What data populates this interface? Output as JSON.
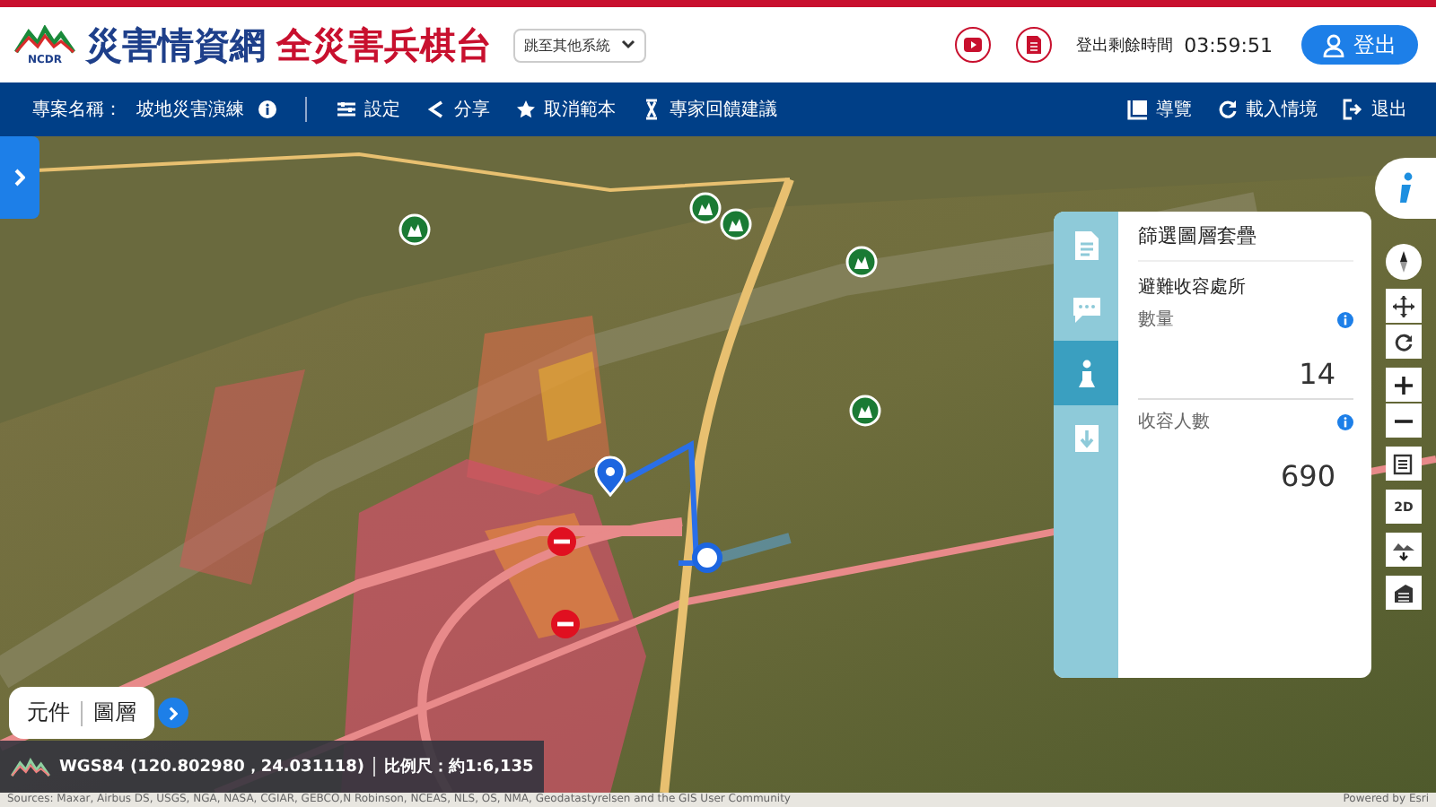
{
  "header": {
    "logo_caption": "NCDR",
    "title_main": "災害情資網",
    "title_sub": "全災害兵棋台",
    "system_select": {
      "value": "跳至其他系統"
    },
    "countdown_label": "登出剩餘時間",
    "countdown": "03:59:51",
    "logout_button": "登出"
  },
  "toolbar": {
    "project_label": "專案名稱：",
    "project_name": "坡地災害演練",
    "left_items": [
      {
        "kind": "settings",
        "label": "設定"
      },
      {
        "kind": "share",
        "label": "分享"
      },
      {
        "kind": "star",
        "label": "取消範本"
      },
      {
        "kind": "feedback",
        "label": "專家回饋建議"
      }
    ],
    "right_items": [
      {
        "kind": "guide",
        "label": "導覽"
      },
      {
        "kind": "reload",
        "label": "載入情境"
      },
      {
        "kind": "exit",
        "label": "退出"
      }
    ]
  },
  "panel": {
    "title": "篩選圖層套疊",
    "tabs": [
      {
        "kind": "document",
        "selected": false
      },
      {
        "kind": "chat",
        "selected": false
      },
      {
        "kind": "person",
        "selected": true
      },
      {
        "kind": "download",
        "selected": false
      }
    ],
    "section": "避難收容處所",
    "metrics": [
      {
        "label": "數量",
        "value": "14"
      },
      {
        "label": "收容人數",
        "value": "690"
      }
    ]
  },
  "map_tools": {
    "view_button": "2D"
  },
  "bottom_toggle": {
    "items": [
      "元件",
      "圖層"
    ]
  },
  "status": {
    "coordinates": "WGS84 (120.802980，24.031118)",
    "scale": "比例尺：約1:6,135"
  },
  "attribution": {
    "sources": "Sources: Maxar, Airbus DS, USGS, NGA, NASA, CGIAR, GEBCO,N Robinson, NCEAS, NLS, OS, NMA, Geodatastyrelsen and the GIS User Community",
    "powered": "Powered by Esri"
  }
}
